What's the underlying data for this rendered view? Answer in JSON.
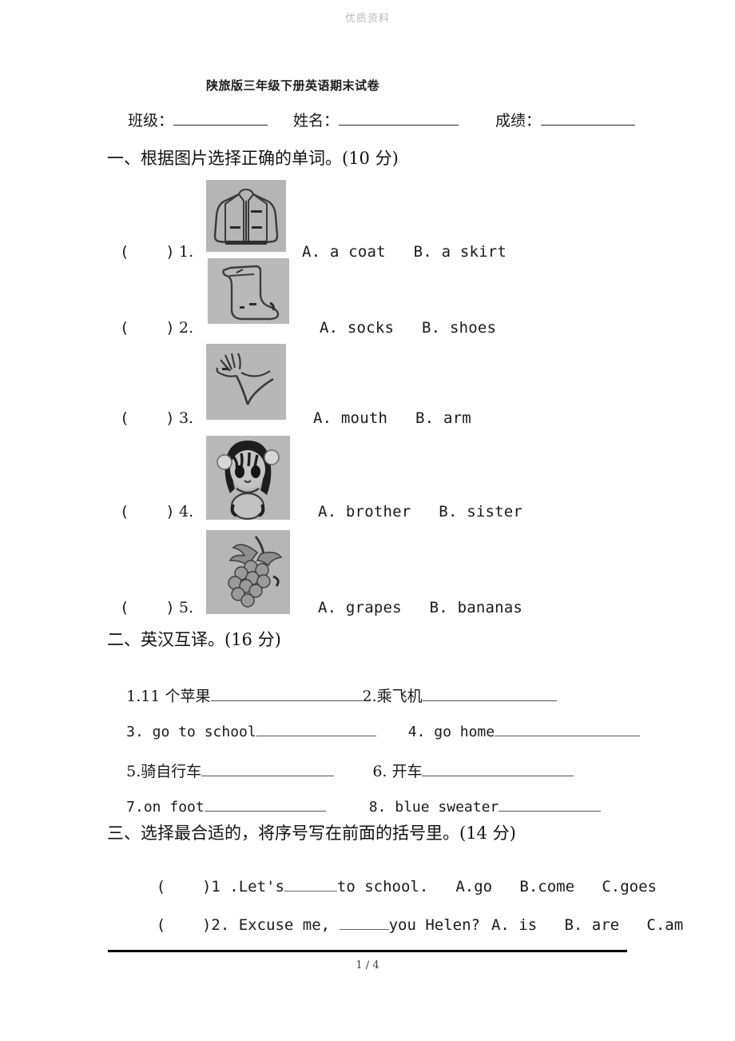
{
  "watermark": "优质资料",
  "title": "陕旅版三年级下册英语期末试卷",
  "info": {
    "class_label": "班级：",
    "name_label": "姓名：",
    "score_label": "成绩："
  },
  "sections": [
    {
      "heading": "一、根据图片选择正确的单词。(10 分)"
    },
    {
      "heading": "二、英汉互译。(16 分)"
    },
    {
      "heading": "三、选择最合适的，将序号写在前面的括号里。(14 分)"
    }
  ],
  "picture_questions": [
    {
      "bracket": "(    )",
      "number": "1.",
      "image": "coat-picture",
      "choices": "A. a coat   B. a skirt"
    },
    {
      "bracket": "(    )",
      "number": "2.",
      "image": "socks-picture",
      "choices": "A. socks   B. shoes"
    },
    {
      "bracket": "(    )",
      "number": "3.",
      "image": "arm-picture",
      "choices": "A. mouth   B. arm"
    },
    {
      "bracket": "(    )",
      "number": "4.",
      "image": "girl-picture",
      "choices": "A. brother   B. sister"
    },
    {
      "bracket": "(    )",
      "number": "5.",
      "image": "grapes-picture",
      "choices": "A. grapes   B. bananas"
    }
  ],
  "translate_items": [
    {
      "left_text": "1.11 个苹果",
      "right_text": "2.乘飞机"
    },
    {
      "left_text": "3. go to school",
      "right_text": "4. go home"
    },
    {
      "left_text": "5.骑自行车",
      "right_text": "6. 开车"
    },
    {
      "left_text": "7.on foot",
      "right_text": "8. blue sweater"
    }
  ],
  "choice_questions": [
    {
      "bracket": "(    )",
      "stem_before": "1 .Let's",
      "stem_after": "to school.",
      "options": "A.go   B.come   C.goes"
    },
    {
      "bracket": "(    )",
      "stem_before": "2. Excuse me, ",
      "stem_after": "you Helen?",
      "options": "A. is   B. are   C.am"
    }
  ],
  "footer": {
    "page_indicator": "1 / 4"
  }
}
